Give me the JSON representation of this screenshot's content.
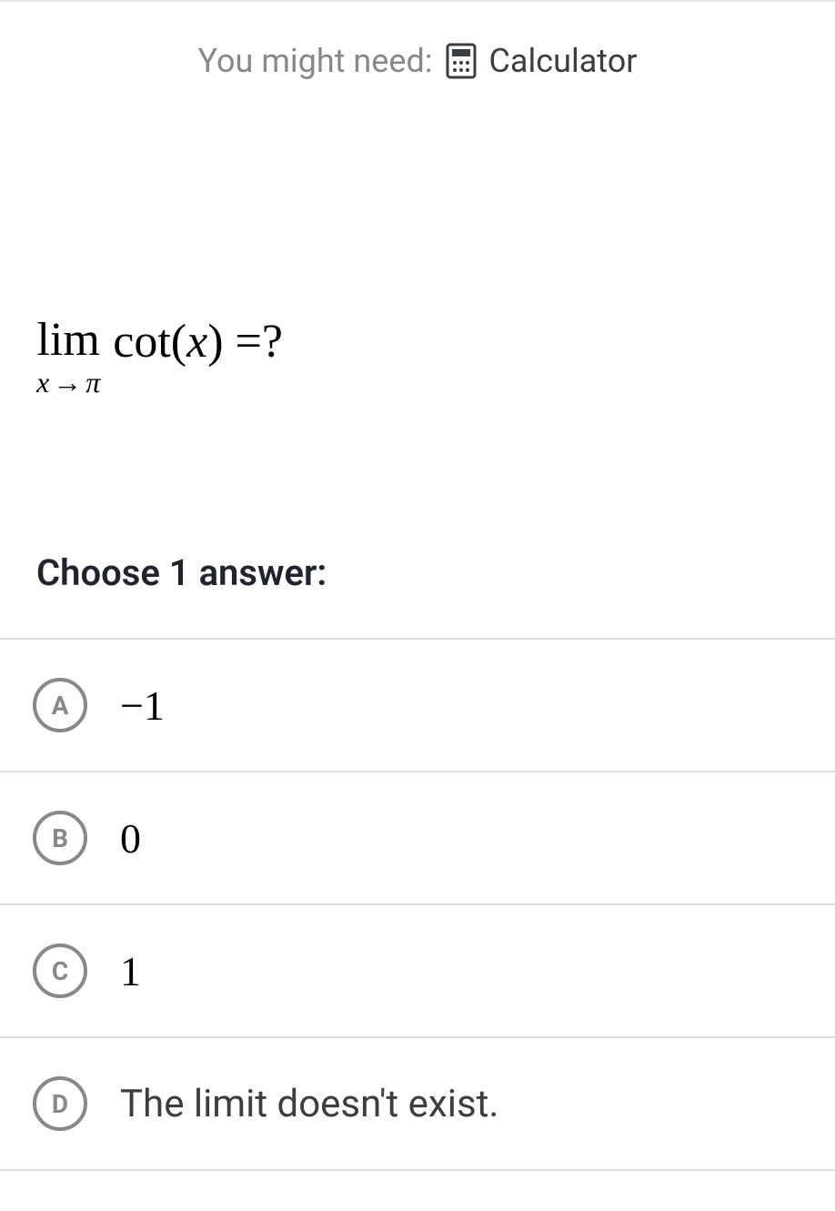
{
  "hint": {
    "prefix": "You might need:",
    "tool": "Calculator"
  },
  "question": {
    "lim_label": "lim",
    "lim_sub_var": "x",
    "lim_sub_arrow": "→",
    "lim_sub_target": "π",
    "func": "cot",
    "func_arg": "x",
    "equals_q": " =?"
  },
  "prompt": "Choose 1 answer:",
  "choices": [
    {
      "letter": "A",
      "text": "−1",
      "math": true
    },
    {
      "letter": "B",
      "text": "0",
      "math": true
    },
    {
      "letter": "C",
      "text": "1",
      "math": true
    },
    {
      "letter": "D",
      "text": "The limit doesn't exist.",
      "math": false
    }
  ]
}
